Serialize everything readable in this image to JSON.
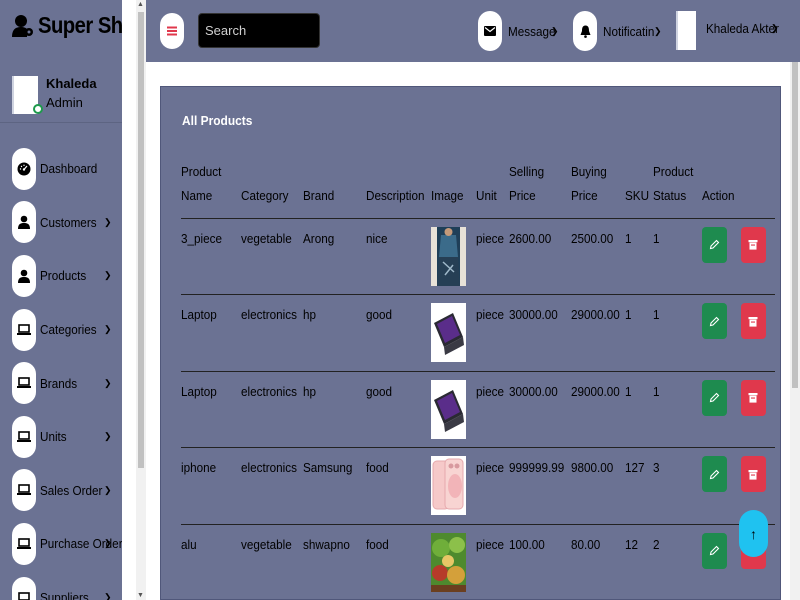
{
  "app": {
    "brand": "Super Shope"
  },
  "profile": {
    "name": "Khaleda",
    "role": "Admin"
  },
  "header": {
    "search_placeholder": "Search",
    "message_label": "Message",
    "notification_label": "Notificatin",
    "user_name": "Khaleda Akter"
  },
  "sidebar": {
    "items": [
      {
        "label": "Dashboard",
        "icon": "gauge-icon",
        "has_submenu": false
      },
      {
        "label": "Customers",
        "icon": "user-icon",
        "has_submenu": true
      },
      {
        "label": "Products",
        "icon": "user-icon",
        "has_submenu": true
      },
      {
        "label": "Categories",
        "icon": "laptop-icon",
        "has_submenu": true
      },
      {
        "label": "Brands",
        "icon": "laptop-icon",
        "has_submenu": true
      },
      {
        "label": "Units",
        "icon": "laptop-icon",
        "has_submenu": true
      },
      {
        "label": "Sales Order",
        "icon": "laptop-icon",
        "has_submenu": true
      },
      {
        "label": "Purchase Order",
        "icon": "laptop-icon",
        "has_submenu": true
      },
      {
        "label": "Suppliers",
        "icon": "laptop-icon",
        "has_submenu": true
      }
    ]
  },
  "panel": {
    "title": "All Products"
  },
  "table": {
    "headers": {
      "product_name": [
        "Product",
        "Name"
      ],
      "category": "Category",
      "brand": "Brand",
      "description": "Description",
      "image": "Image",
      "unit": "Unit",
      "selling_price": [
        "Selling",
        "Price"
      ],
      "buying_price": [
        "Buying",
        "Price"
      ],
      "sku": "SKU",
      "product_status": [
        "Product",
        "Status"
      ],
      "action": "Action"
    },
    "rows": [
      {
        "name": "3_piece",
        "category": "vegetable",
        "brand": "Arong",
        "description": "nice",
        "image": "dress-photo",
        "unit": "piece",
        "selling_price": "2600.00",
        "buying_price": "2500.00",
        "sku": "1",
        "status": "1"
      },
      {
        "name": "Laptop",
        "category": "electronics",
        "brand": "hp",
        "description": "good",
        "image": "laptop-photo",
        "unit": "piece",
        "selling_price": "30000.00",
        "buying_price": "29000.00",
        "sku": "1",
        "status": "1"
      },
      {
        "name": "Laptop",
        "category": "electronics",
        "brand": "hp",
        "description": "good",
        "image": "laptop-photo",
        "unit": "piece",
        "selling_price": "30000.00",
        "buying_price": "29000.00",
        "sku": "1",
        "status": "1"
      },
      {
        "name": "iphone",
        "category": "electronics",
        "brand": "Samsung",
        "description": "food",
        "image": "phone-photo",
        "unit": "piece",
        "selling_price": "999999.99",
        "buying_price": "9800.00",
        "sku": "127",
        "status": "3"
      },
      {
        "name": "alu",
        "category": "vegetable",
        "brand": "shwapno",
        "description": "food",
        "image": "vegetable-photo",
        "unit": "piece",
        "selling_price": "100.00",
        "buying_price": "80.00",
        "sku": "12",
        "status": "2"
      }
    ]
  },
  "colors": {
    "panel_bg": "#6b7293",
    "edit": "#1e8b4f",
    "delete": "#e0384c",
    "scroll_top": "#1fc2f0"
  }
}
